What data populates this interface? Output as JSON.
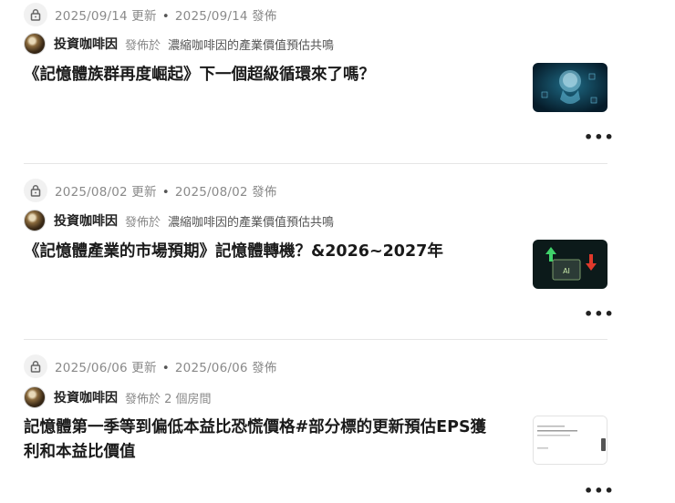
{
  "posts": [
    {
      "updated": "2025/09/14 更新",
      "published": "2025/09/14 發佈",
      "author": "投資咖啡因",
      "posted_in": "發佈於",
      "room": "濃縮咖啡因的產業價值預估共鳴",
      "title": "《記憶體族群再度崛起》下一個超級循環來了嗎？",
      "thumbnail": "ai-robot-head"
    },
    {
      "updated": "2025/08/02 更新",
      "published": "2025/08/02 發佈",
      "author": "投資咖啡因",
      "posted_in": "發佈於",
      "room": "濃縮咖啡因的產業價值預估共鳴",
      "title": "《記憶體產業的市場預期》記憶體轉機？&2026~2027年",
      "thumbnail": "ai-chip-arrows"
    },
    {
      "updated": "2025/06/06 更新",
      "published": "2025/06/06 發佈",
      "author": "投資咖啡因",
      "posted_in": "發佈於 2 個房間",
      "room": "",
      "title": "記憶體第一季等到偏低本益比恐慌價格#部分標的更新預估EPS獲利和本益比價值",
      "thumbnail": "document-screenshot"
    }
  ],
  "icons": {
    "lock": "lock-icon",
    "more": "more-options-icon"
  },
  "more_label": "•••",
  "separator": "•"
}
